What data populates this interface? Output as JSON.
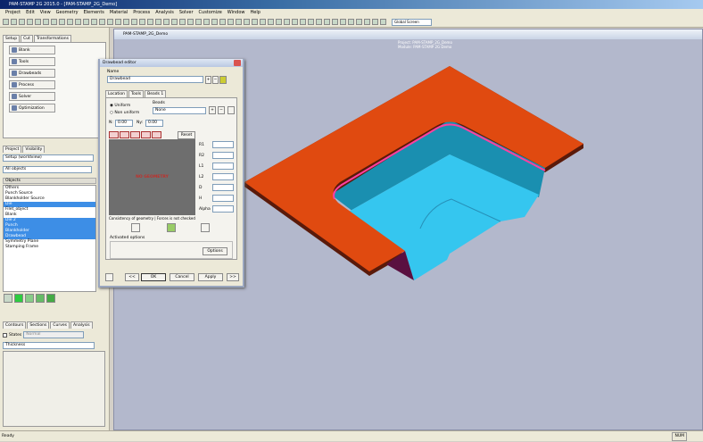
{
  "window": {
    "title": "PAM-STAMP 2G 2015.0 - [PAM-STAMP_2G_Demo]"
  },
  "menu": [
    "Project",
    "Edit",
    "View",
    "Geometry",
    "Elements",
    "Material",
    "Process",
    "Analysis",
    "Solver",
    "Customize",
    "Window",
    "Help"
  ],
  "toolbar": {
    "view_select": "Global Screen"
  },
  "left": {
    "top_tabs": [
      "Setup",
      "Cut",
      "Transformations"
    ],
    "steps": [
      "Blank",
      "Tools",
      "Drawbeads",
      "Process",
      "Solver",
      "Optimization"
    ],
    "project_tabs": [
      "Project",
      "Visibility"
    ],
    "setup_field": "Setup (worldview)",
    "filter_select": "All objects",
    "objects_header": "Objects",
    "objects": [
      {
        "label": "Others",
        "selected": false
      },
      {
        "label": "Punch Source",
        "selected": false
      },
      {
        "label": "Blankholder Source",
        "selected": false
      },
      {
        "label": "Die",
        "selected": true
      },
      {
        "label": "Filet_object",
        "selected": false
      },
      {
        "label": "Blank",
        "selected": false
      },
      {
        "label": "Die 2",
        "selected": true
      },
      {
        "label": "Punch",
        "selected": true
      },
      {
        "label": "Blankholder",
        "selected": true
      },
      {
        "label": "Drawbead",
        "selected": true
      },
      {
        "label": "Symmetry Plane",
        "selected": false
      },
      {
        "label": "Stamping Frame",
        "selected": false
      }
    ],
    "bottom_tabs": [
      "Contours",
      "Sections",
      "Curves",
      "Analysis"
    ],
    "states_label": "States",
    "states_value": "Normal",
    "thickness_select": "Thickness"
  },
  "viewport": {
    "title": "PAM-STAMP_2G_Demo",
    "project_line": "Project: PAM-STAMP_2G_Demo",
    "module_line": "Module: PAM-STAMP 2G Demo",
    "colors": {
      "plate": "#e04a10",
      "plate_edge": "#5a1a0a",
      "cavity_wall": "#1a8fb0",
      "cavity_floor": "#35c6ef",
      "rim": "#ff3fa0"
    }
  },
  "dialog": {
    "title": "Drawbead editor",
    "name_label": "Name",
    "name_value": "Drawbead",
    "tabs": [
      "Location",
      "Tools",
      "Beads 1"
    ],
    "uniform": "Uniform",
    "non_uniform": "Non uniform",
    "beads_label": "Beads",
    "beads_value": "None",
    "n_label": "N:",
    "n_value": "0.00",
    "ny_label": "Ny:",
    "ny_value": "0.00",
    "reset": "Reset",
    "no_geometry": "NO GEOMETRY",
    "params": [
      "R1",
      "R2",
      "L1",
      "L2",
      "D",
      "H",
      "Alpha"
    ],
    "status": "Consistency of geometry  |  Forces is not checked",
    "activated_options": "Activated options",
    "options": "Options",
    "prev": "<<",
    "ok": "OK",
    "cancel": "Cancel",
    "apply": "Apply",
    "next": ">>"
  },
  "status": {
    "text": "Ready",
    "num": "NUM"
  }
}
